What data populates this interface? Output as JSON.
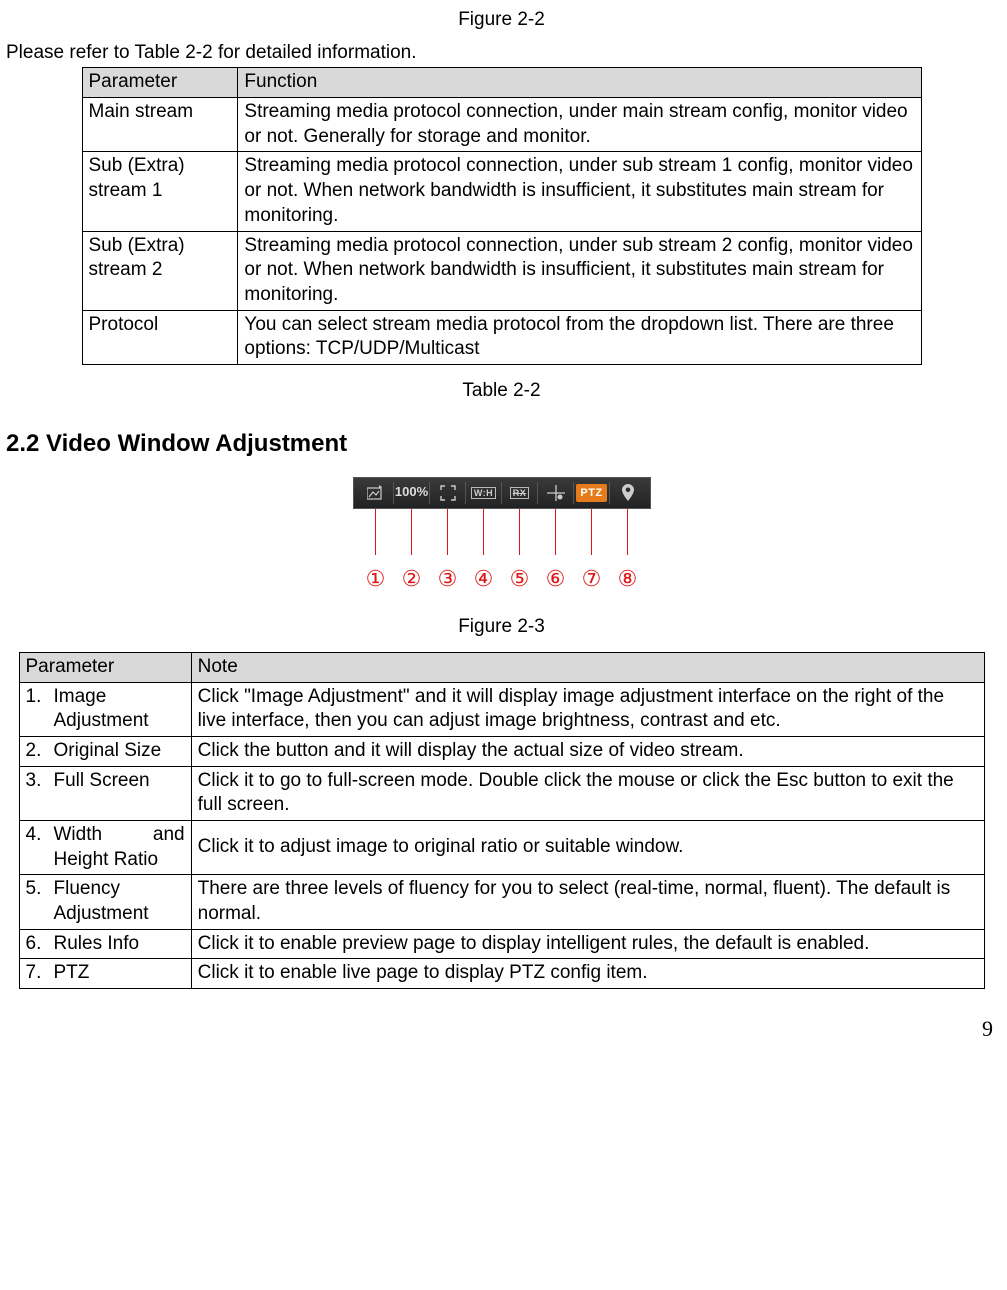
{
  "captions": {
    "figure_2_2": "Figure 2-2",
    "table_2_2": "Table 2-2",
    "figure_2_3": "Figure 2-3"
  },
  "intro_text": "Please refer to Table 2-2 for detailed information.",
  "table_2_2": {
    "headers": [
      "Parameter",
      "Function"
    ],
    "rows": [
      {
        "param": "Main stream",
        "func": "Streaming media protocol connection, under main stream config, monitor video or not. Generally for storage and monitor."
      },
      {
        "param": "Sub (Extra) stream 1",
        "func": "Streaming media protocol connection, under sub stream 1 config, monitor video or not. When network bandwidth is insufficient, it substitutes main stream for monitoring."
      },
      {
        "param": "Sub (Extra) stream 2",
        "func": "Streaming media protocol connection, under sub stream 2 config, monitor video or not. When network bandwidth is insufficient, it substitutes main stream for monitoring."
      },
      {
        "param": "Protocol",
        "func": "You can select stream media protocol from the dropdown list. There are three options: TCP/UDP/Multicast"
      }
    ]
  },
  "section_heading": "2.2  Video Window Adjustment",
  "toolbar": {
    "items": [
      {
        "name": "image-adjustment-icon",
        "kind": "svg-img-adj"
      },
      {
        "name": "original-size-icon",
        "kind": "text",
        "label": "100%"
      },
      {
        "name": "fullscreen-icon",
        "kind": "svg-fullscreen"
      },
      {
        "name": "wh-ratio-icon",
        "kind": "box",
        "label": "W:H"
      },
      {
        "name": "fluency-icon",
        "kind": "box",
        "label": "RX"
      },
      {
        "name": "rules-info-icon",
        "kind": "svg-rules"
      },
      {
        "name": "ptz-icon",
        "kind": "ptz",
        "label": "PTZ"
      },
      {
        "name": "zoom-focus-icon",
        "kind": "svg-pin"
      }
    ],
    "circled_numbers": [
      "①",
      "②",
      "③",
      "④",
      "⑤",
      "⑥",
      "⑦",
      "⑧"
    ]
  },
  "table_2_3": {
    "headers": [
      "Parameter",
      "Note"
    ],
    "rows": [
      {
        "num": "1.",
        "param": "Image Adjustment",
        "note": "Click \"Image Adjustment\" and it will display image adjustment interface on the right of the live interface, then you can adjust image brightness, contrast and etc."
      },
      {
        "num": "2.",
        "param": "Original Size",
        "note": "Click the button and it will display the actual size of video stream."
      },
      {
        "num": "3.",
        "param": "Full Screen",
        "note": "Click it to go to full-screen mode.  Double click the mouse or click the Esc button to exit the full screen."
      },
      {
        "num": "4.",
        "param": "Width and Height Ratio",
        "justify": true,
        "note": "Click it to adjust image to original ratio or suitable window."
      },
      {
        "num": "5.",
        "param": "Fluency Adjustment",
        "note": "There are three levels of fluency for you to select (real-time, normal, fluent). The default is normal."
      },
      {
        "num": "6.",
        "param": "Rules Info",
        "note": "Click it to enable preview page to display intelligent rules, the default is enabled."
      },
      {
        "num": "7.",
        "param": "PTZ",
        "note": "Click it to enable live page to display PTZ config item."
      }
    ]
  },
  "page_number": "9"
}
